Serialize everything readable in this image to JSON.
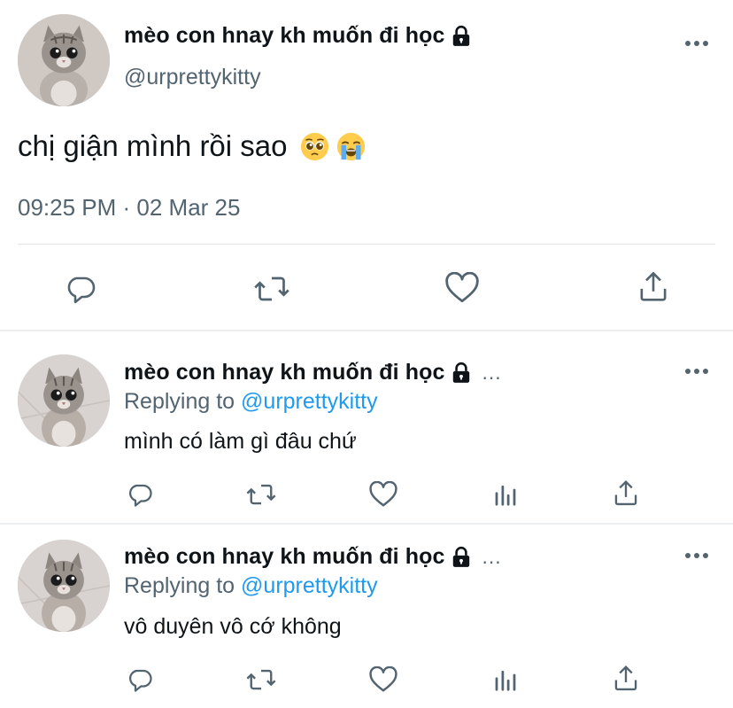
{
  "main_tweet": {
    "display_name": "mèo con hnay kh muốn đi học",
    "handle": "@urprettykitty",
    "text": "chị giận mình rồi sao",
    "emojis": [
      "pleading-face-emoji",
      "loudly-crying-face-emoji"
    ],
    "timestamp": "09:25 PM · 02 Mar 25",
    "actions": [
      "reply-icon",
      "retweet-icon",
      "like-icon",
      "share-icon"
    ]
  },
  "replies": [
    {
      "display_name": "mèo con hnay kh muốn đi học",
      "trail": "...",
      "replying_prefix": "Replying to",
      "replying_handle": "@urprettykitty",
      "text": "mình có làm gì đâu chứ",
      "actions": [
        "reply-icon",
        "retweet-icon",
        "like-icon",
        "analytics-icon",
        "share-icon"
      ]
    },
    {
      "display_name": "mèo con hnay kh muốn đi học",
      "trail": "...",
      "replying_prefix": "Replying to",
      "replying_handle": "@urprettykitty",
      "text": "vô duyên vô cớ không",
      "actions": [
        "reply-icon",
        "retweet-icon",
        "like-icon",
        "analytics-icon",
        "share-icon"
      ]
    }
  ],
  "colors": {
    "text": "#0f1419",
    "secondary": "#536471",
    "mention": "#1d9bf0",
    "divider": "#e2e6e9"
  }
}
